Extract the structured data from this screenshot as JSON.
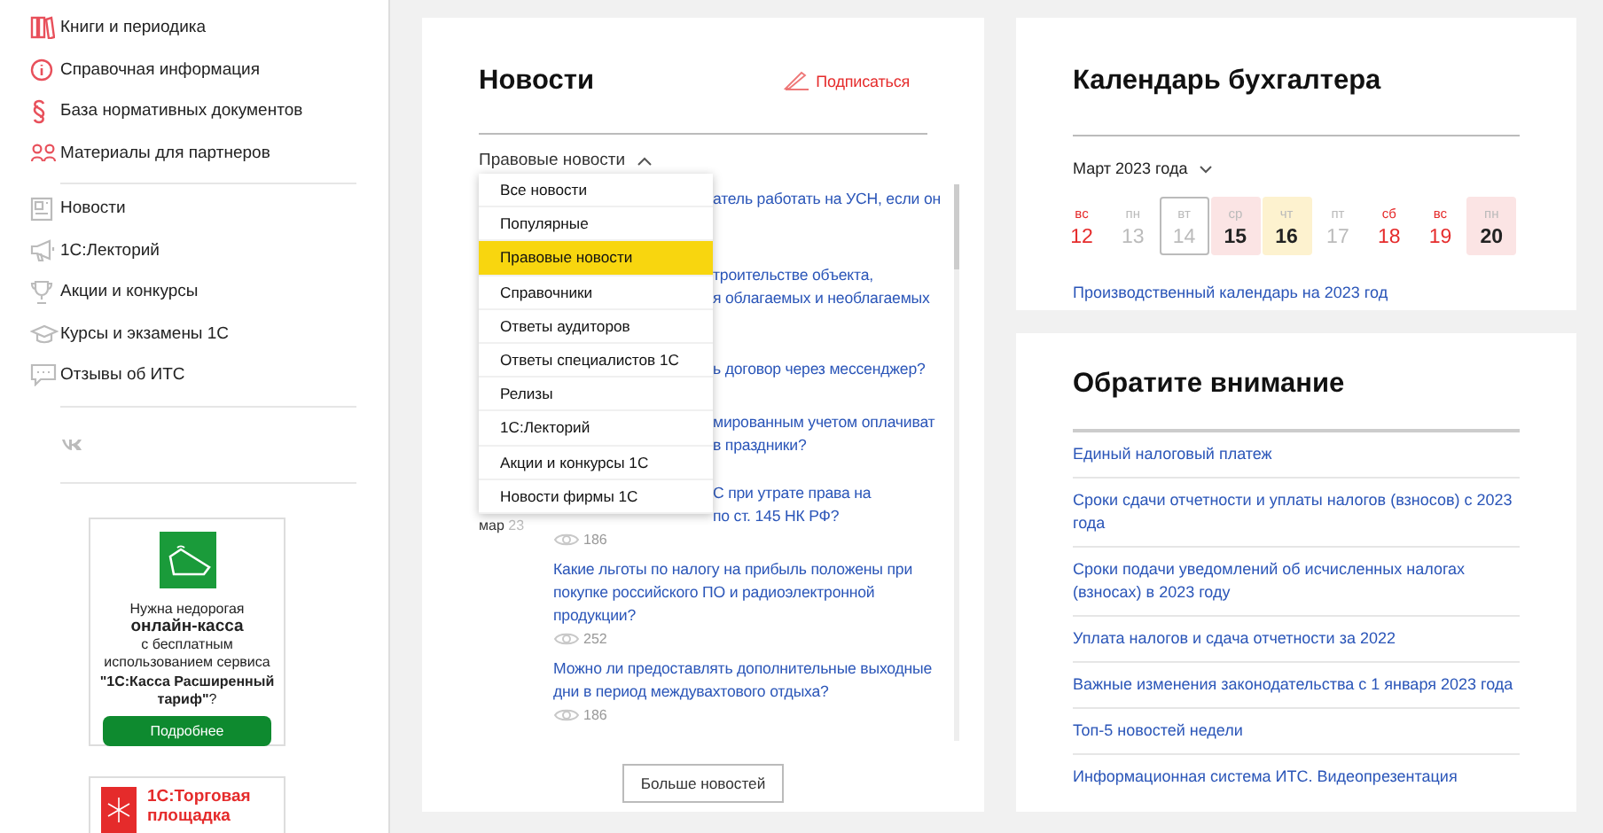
{
  "sidebar": {
    "groups": [
      {
        "items": [
          {
            "label": "Книги и периодика"
          },
          {
            "label": "Справочная информация"
          },
          {
            "label": "База нормативных документов"
          },
          {
            "label": "Материалы для партнеров"
          }
        ]
      },
      {
        "items": [
          {
            "label": "Новости"
          },
          {
            "label": "1С:Лекторий"
          },
          {
            "label": "Акции и конкурсы"
          },
          {
            "label": "Курсы и экзамены 1С"
          },
          {
            "label": "Отзывы об ИТС"
          }
        ]
      }
    ],
    "ad": {
      "lines": [
        "Нужна недорогая",
        "**онлайн-касса**",
        "с бесплатным использованием сервиса **\"1С:Касса Расширенный тариф\"**?"
      ],
      "button": "Подробнее"
    },
    "promo": "1С:Торговая площадка"
  },
  "news": {
    "title": "Новости",
    "subscribe": "Подписаться",
    "filter": {
      "label": "Правовые новости",
      "expanded": true
    },
    "menu": [
      {
        "label": "Все новости",
        "selected": false
      },
      {
        "label": "Популярные",
        "selected": false
      },
      {
        "label": "Правовые новости",
        "selected": true
      },
      {
        "label": "Справочники",
        "selected": false
      },
      {
        "label": "Ответы аудиторов",
        "selected": false
      },
      {
        "label": "Ответы специалистов 1С",
        "selected": false
      },
      {
        "label": "Релизы",
        "selected": false
      },
      {
        "label": "1С:Лекторий",
        "selected": false
      },
      {
        "label": "Акции и конкурсы 1С",
        "selected": false
      },
      {
        "label": "Новости фирмы 1С",
        "selected": false
      }
    ],
    "items": [
      {
        "kind": "covered",
        "lines": [
          "атель работать на УСН, если он"
        ]
      },
      {
        "kind": "covered",
        "lines": [
          "троительстве объекта,",
          "я облагаемых и необлагаемых"
        ]
      },
      {
        "kind": "covered",
        "lines": [
          "ь договор через мессенджер?"
        ]
      },
      {
        "kind": "covered",
        "lines": [
          "мированным учетом оплачиват",
          "в праздники?"
        ]
      },
      {
        "kind": "covered",
        "lines": [
          "С при утрате права на",
          "по ст. 145 НК РФ?"
        ],
        "month": "мар",
        "day": "23",
        "views": "186"
      },
      {
        "kind": "plain",
        "lines": [
          "Какие льготы по налогу на прибыль положены при",
          "покупке российского ПО и радиоэлектронной",
          "продукции?"
        ],
        "views": "252"
      },
      {
        "kind": "plain",
        "lines": [
          "Можно ли предоставлять дополнительные выходные",
          "дни в период междувахтового отдыха?"
        ],
        "views": "186"
      }
    ],
    "more": "Больше новостей"
  },
  "calendar": {
    "title": "Календарь бухгалтера",
    "month": "Март 2023 года",
    "days": [
      {
        "dow": "вс",
        "num": "12",
        "kind": "weekend"
      },
      {
        "dow": "пн",
        "num": "13",
        "kind": "plain"
      },
      {
        "dow": "вт",
        "num": "14",
        "kind": "today"
      },
      {
        "dow": "ср",
        "num": "15",
        "kind": "deadline"
      },
      {
        "dow": "чт",
        "num": "16",
        "kind": "report"
      },
      {
        "dow": "пт",
        "num": "17",
        "kind": "plain"
      },
      {
        "dow": "сб",
        "num": "18",
        "kind": "weekend"
      },
      {
        "dow": "вс",
        "num": "19",
        "kind": "weekend"
      },
      {
        "dow": "пн",
        "num": "20",
        "kind": "deadline"
      }
    ],
    "link": "Производственный календарь на 2023 год"
  },
  "attention": {
    "title": "Обратите внимание",
    "links": [
      "Единый налоговый платеж",
      "Сроки сдачи отчетности и уплаты налогов (взносов) с 2023 года",
      "Сроки подачи уведомлений об исчисленных налогах (взносах) в 2023 году",
      "Уплата налогов и сдача отчетности за 2022",
      "Важные изменения законодательства с 1 января 2023 года",
      "Топ-5 новостей недели",
      "Информационная система ИТС. Видеопрезентация"
    ]
  }
}
